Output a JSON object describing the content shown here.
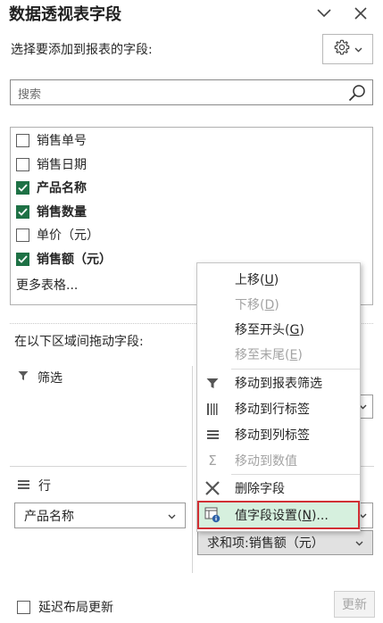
{
  "panel": {
    "title": "数据透视表字段",
    "choose_label": "选择要添加到报表的字段:",
    "search_placeholder": "搜索",
    "more_tables": "更多表格...",
    "drag_label": "在以下区域间拖动字段:"
  },
  "fields": [
    {
      "label": "销售单号",
      "checked": false
    },
    {
      "label": "销售日期",
      "checked": false
    },
    {
      "label": "产品名称",
      "checked": true
    },
    {
      "label": "销售数量",
      "checked": true
    },
    {
      "label": "单价（元）",
      "checked": false
    },
    {
      "label": "销售额（元）",
      "checked": true
    }
  ],
  "areas": {
    "filter_title": "筛选",
    "rows_title": "行",
    "rows_item": "产品名称",
    "values_item": "求和项:销售额（元）"
  },
  "context_menu": {
    "move_up": "上移",
    "move_up_key": "U",
    "move_down": "下移",
    "move_down_key": "D",
    "move_to_start": "移至开头",
    "move_to_start_key": "G",
    "move_to_end": "移至末尾",
    "move_to_end_key": "E",
    "move_to_report_filter": "移动到报表筛选",
    "move_to_row_labels": "移动到行标签",
    "move_to_column_labels": "移动到列标签",
    "move_to_values": "移动到数值",
    "remove_field": "删除字段",
    "value_field_settings": "值字段设置",
    "value_field_settings_key": "N"
  },
  "footer": {
    "defer_label": "延迟布局更新",
    "update_label": "更新"
  },
  "colors": {
    "checkbox_checked": "#1e7145",
    "menu_highlight": "#d6f0de",
    "highlight_border": "#d12f34",
    "values_item_bg": "#e1e1e1"
  }
}
